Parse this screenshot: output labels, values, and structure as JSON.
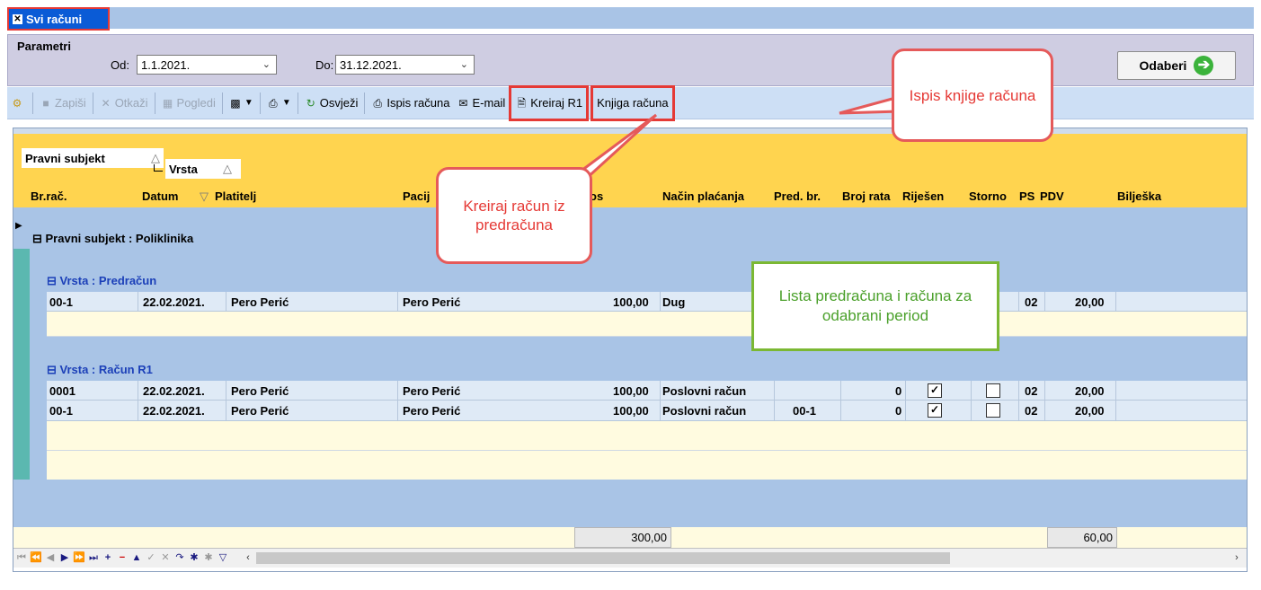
{
  "window": {
    "tab_title": "Svi računi",
    "tab_close_glyph": "✕"
  },
  "params": {
    "section_label": "Parametri",
    "from_label": "Od:",
    "from_value": "1.1.2021.",
    "to_label": "Do:",
    "to_value": "31.12.2021.",
    "select_button": "Odaberi",
    "select_icon": "arrow-right-circle"
  },
  "toolbar": {
    "save": "Zapiši",
    "cancel": "Otkaži",
    "views": "Pogledi",
    "refresh": "Osvježi",
    "print_invoice": "Ispis računa",
    "email": "E-mail",
    "create_r1": "Kreiraj R1",
    "invoice_book": "Knjiga računa"
  },
  "grid": {
    "group_chips": [
      "Pravni subjekt",
      "Vrsta"
    ],
    "columns": [
      "Br.rač.",
      "Datum",
      "Platitelj",
      "Pacij",
      "os",
      "Način plaćanja",
      "Pred. br.",
      "Broj rata",
      "Riješen",
      "Storno",
      "PS",
      "PDV",
      "Bilješka"
    ],
    "group_level1": "Pravni subjekt : Poliklinika",
    "group_predracun": "Vrsta : Predračun",
    "group_racun": "Vrsta : Račun R1",
    "predracun_rows": [
      {
        "br": "00-1",
        "datum": "22.02.2021.",
        "platitelj": "Pero Perić",
        "pacijent": "Pero Perić",
        "iznos": "100,00",
        "nacin": "Dug",
        "pred": "",
        "rata": "",
        "ps": "02",
        "pdv": "20,00"
      }
    ],
    "racun_rows": [
      {
        "br": "0001",
        "datum": "22.02.2021.",
        "platitelj": "Pero Perić",
        "pacijent": "Pero Perić",
        "iznos": "100,00",
        "nacin": "Poslovni račun",
        "pred": "",
        "rata": "0",
        "rijesen": true,
        "storno": false,
        "ps": "02",
        "pdv": "20,00"
      },
      {
        "br": "00-1",
        "datum": "22.02.2021.",
        "platitelj": "Pero Perić",
        "pacijent": "Pero Perić",
        "iznos": "100,00",
        "nacin": "Poslovni račun",
        "pred": "00-1",
        "rata": "0",
        "rijesen": true,
        "storno": false,
        "ps": "02",
        "pdv": "20,00"
      }
    ],
    "sum_iznos": "300,00",
    "sum_pdv": "60,00"
  },
  "callouts": {
    "invoice_book_note": "Ispis knjige računa",
    "create_from_quote_note": "Kreiraj račun iz predračuna",
    "list_note": "Lista predračuna i računa za odabrani period"
  },
  "colors": {
    "accent_red": "#e53935",
    "accent_green": "#7bb833",
    "group_yellow": "#ffd44f",
    "tab_blue": "#0a5bd6"
  }
}
